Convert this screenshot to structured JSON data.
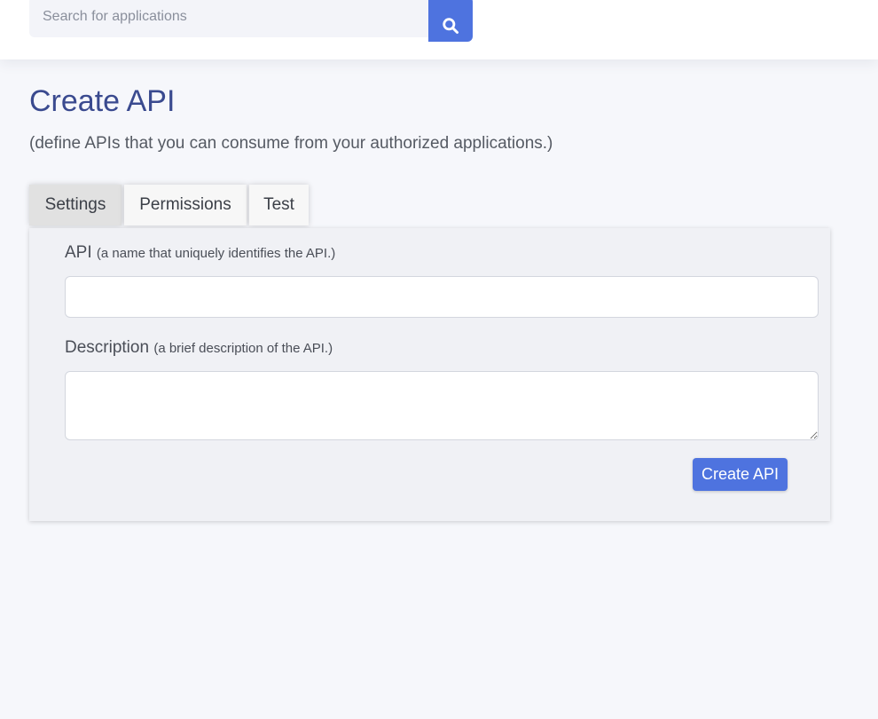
{
  "search": {
    "placeholder": "Search for applications",
    "button_icon": "search-icon"
  },
  "header": {
    "title": "Create API",
    "subtitle": "(define APIs that you can consume from your authorized applications.)"
  },
  "tabs": [
    {
      "label": "Settings",
      "active": true
    },
    {
      "label": "Permissions",
      "active": false
    },
    {
      "label": "Test",
      "active": false
    }
  ],
  "form": {
    "api_label": "API",
    "api_hint": "(a name that uniquely identifies the API.)",
    "api_value": "",
    "description_label": "Description",
    "description_hint": "(a brief description of the API.)",
    "description_value": "",
    "submit_label": "Create API"
  },
  "colors": {
    "accent": "#4e73df",
    "title": "#3a4a8f",
    "background": "#f6f7fb"
  }
}
